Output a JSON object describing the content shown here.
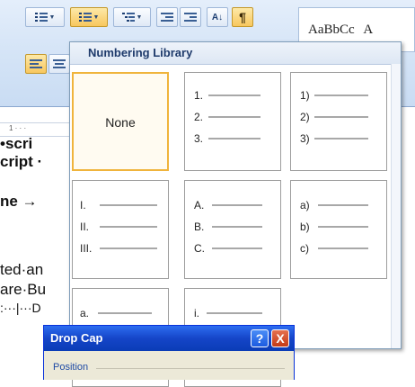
{
  "ribbon": {
    "style_gallery_sample": "AaBbCc",
    "style_gallery_overflow": "A"
  },
  "document": {
    "ruler_text": "1 · · ·",
    "lines": [
      {
        "text": "•scri"
      },
      {
        "text": "cript ·"
      },
      {
        "text": "ne →"
      },
      {
        "text": "ted·an"
      },
      {
        "text": "are·Bu"
      },
      {
        "text": ":···|···D"
      }
    ]
  },
  "numbering_library": {
    "title": "Numbering Library",
    "none_label": "None",
    "formats": [
      {
        "markers": [
          "1.",
          "2.",
          "3."
        ]
      },
      {
        "markers": [
          "1)",
          "2)",
          "3)"
        ]
      },
      {
        "markers": [
          "I.",
          "II.",
          "III."
        ]
      },
      {
        "markers": [
          "A.",
          "B.",
          "C."
        ]
      },
      {
        "markers": [
          "a)",
          "b)",
          "c)"
        ]
      },
      {
        "markers": [
          "a."
        ]
      },
      {
        "markers": [
          "i."
        ]
      }
    ]
  },
  "drop_cap_dialog": {
    "title": "Drop Cap",
    "help_label": "?",
    "close_label": "X",
    "position_label": "Position"
  }
}
